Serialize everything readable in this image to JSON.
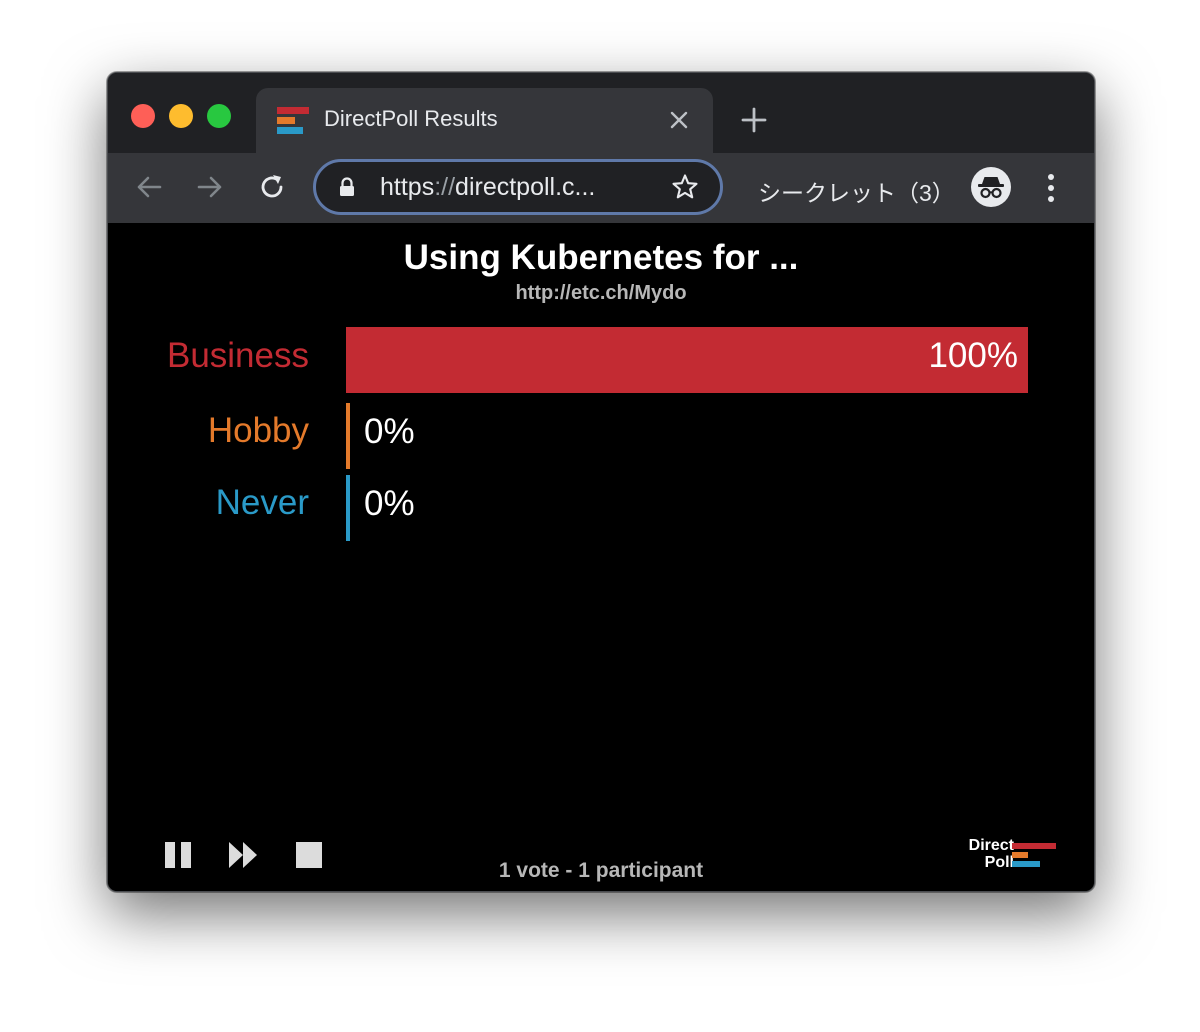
{
  "browser": {
    "tab": {
      "title": "DirectPoll Results"
    },
    "address_bar": {
      "scheme": "https",
      "separator": "://",
      "rest": "directpoll.c..."
    },
    "incognito_label": "シークレット（3）",
    "icons": [
      "close-icon",
      "plus-icon",
      "back-arrow-icon",
      "forward-arrow-icon",
      "reload-icon",
      "lock-icon",
      "star-icon",
      "incognito-icon",
      "more-vertical-icon"
    ]
  },
  "poll": {
    "title": "Using Kubernetes for ...",
    "link": "http://etc.ch/Mydo",
    "answers": [
      {
        "label": "Business",
        "percent_text": "100%",
        "share": 1.0,
        "color": "#c32b33"
      },
      {
        "label": "Hobby",
        "percent_text": "0%",
        "share": 0.0,
        "color": "#e47a2b"
      },
      {
        "label": "Never",
        "percent_text": "0%",
        "share": 0.0,
        "color": "#2a9ac8"
      }
    ],
    "footer": "1 vote - 1 participant"
  },
  "brand": {
    "line1": "Direct",
    "line2": "Poll"
  },
  "colors": {
    "tab_strip": "#202124",
    "toolbar": "#35363a",
    "omnibox_border": "#5f79a9",
    "content_bg": "#000000"
  }
}
